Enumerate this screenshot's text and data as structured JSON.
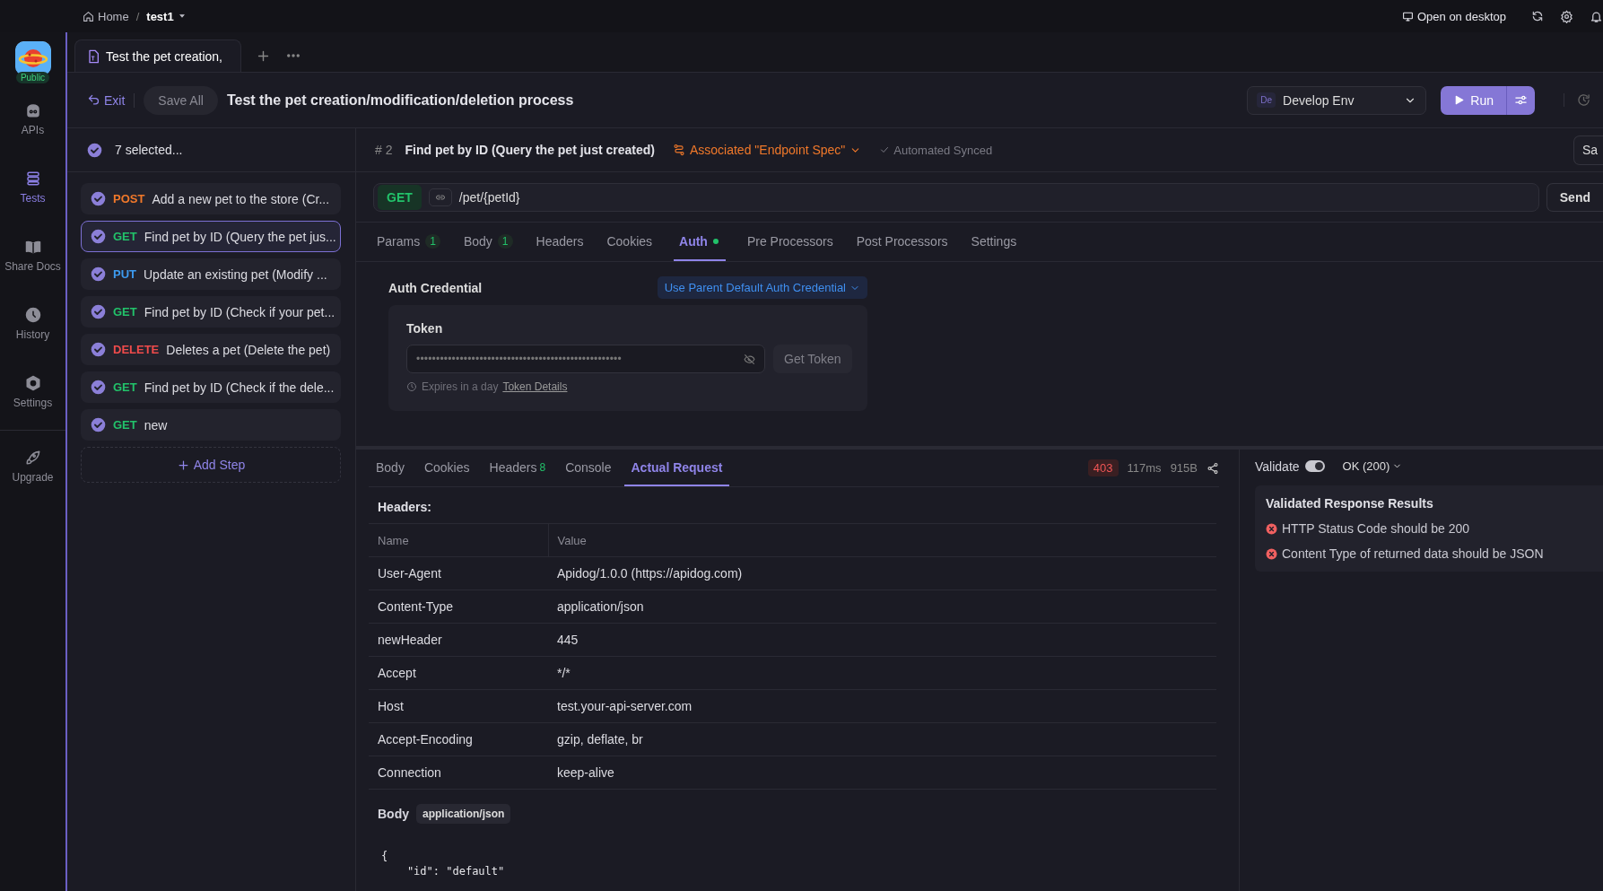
{
  "top_bar": {
    "breadcrumb": [
      {
        "label": "Home",
        "kind": "home"
      },
      {
        "label": "test1",
        "kind": "project"
      }
    ],
    "separator": "/",
    "open_desktop": "Open on desktop"
  },
  "nav": {
    "badge": "Public",
    "items": [
      {
        "label": "APIs",
        "kind": "apis",
        "selected": false
      },
      {
        "label": "Tests",
        "kind": "tests",
        "selected": true
      },
      {
        "label": "Share Docs",
        "kind": "docs",
        "selected": false
      },
      {
        "label": "History",
        "kind": "history",
        "selected": false
      },
      {
        "label": "Settings",
        "kind": "settings",
        "selected": false
      }
    ],
    "upgrade": "Upgrade"
  },
  "tabs": [
    {
      "label": "Test the pet creation,",
      "selected": true
    }
  ],
  "header": {
    "exit": "Exit",
    "save_all": "Save All",
    "title": "Test the pet creation/modification/deletion process",
    "env_badge": "De",
    "env": "Develop Env",
    "run": "Run"
  },
  "steps": {
    "selected_count": "7 selected...",
    "all_checked": true,
    "items": [
      {
        "method": "POST",
        "color": "#f0782a",
        "name": "Add a new pet to the store (Cr...",
        "checked": true,
        "selected": false
      },
      {
        "method": "GET",
        "color": "#22c26a",
        "name": "Find pet by ID (Query the pet jus...",
        "checked": true,
        "selected": true
      },
      {
        "method": "PUT",
        "color": "#3d9bf0",
        "name": "Update an existing pet (Modify ...",
        "checked": true,
        "selected": false
      },
      {
        "method": "GET",
        "color": "#22c26a",
        "name": "Find pet by ID (Check if your pet...",
        "checked": true,
        "selected": false
      },
      {
        "method": "DELETE",
        "color": "#ef4b4b",
        "name": "Deletes a pet (Delete the pet)",
        "checked": true,
        "selected": false
      },
      {
        "method": "GET",
        "color": "#22c26a",
        "name": "Find pet by ID (Check if the dele...",
        "checked": true,
        "selected": false
      },
      {
        "method": "GET",
        "color": "#22c26a",
        "name": "new",
        "checked": true,
        "selected": false
      }
    ],
    "add_step": "Add Step"
  },
  "step": {
    "number": "# 2",
    "title": "Find pet by ID (Query the pet just created)",
    "association": "Associated \"Endpoint Spec\"",
    "sync": "Automated Synced",
    "save": "Sa"
  },
  "request": {
    "method": "GET",
    "url": "/pet/{petId}",
    "send": "Send"
  },
  "request_tabs": [
    {
      "label": "Params",
      "count": "1",
      "selected": false,
      "indicator": false
    },
    {
      "label": "Body",
      "count": "1",
      "selected": false,
      "indicator": false
    },
    {
      "label": "Headers",
      "selected": false,
      "indicator": false
    },
    {
      "label": "Cookies",
      "selected": false,
      "indicator": false
    },
    {
      "label": "Auth",
      "selected": true,
      "indicator": true
    },
    {
      "label": "Pre Processors",
      "selected": false,
      "indicator": false
    },
    {
      "label": "Post Processors",
      "selected": false,
      "indicator": false
    },
    {
      "label": "Settings",
      "selected": false,
      "indicator": false
    }
  ],
  "auth": {
    "label": "Auth Credential",
    "mode": "Use Parent Default Auth Credential",
    "token_label": "Token",
    "token_value": "••••••••••••••••••••••••••••••••••••••••••••••••••••",
    "get_token": "Get Token",
    "expires": "Expires in a day",
    "details": "Token Details"
  },
  "response": {
    "tabs": [
      {
        "label": "Body",
        "selected": false
      },
      {
        "label": "Cookies",
        "selected": false
      },
      {
        "label": "Headers",
        "count": "8",
        "selected": false
      },
      {
        "label": "Console",
        "selected": false
      },
      {
        "label": "Actual Request",
        "selected": true
      }
    ],
    "status": "403",
    "time": "117ms",
    "size": "915B"
  },
  "actual_request": {
    "headers_title": "Headers:",
    "columns": [
      "Name",
      "Value"
    ],
    "rows": [
      [
        "User-Agent",
        "Apidog/1.0.0 (https://apidog.com)"
      ],
      [
        "Content-Type",
        "application/json"
      ],
      [
        "newHeader",
        "445"
      ],
      [
        "Accept",
        "*/*"
      ],
      [
        "Host",
        "test.your-api-server.com"
      ],
      [
        "Accept-Encoding",
        "gzip, deflate, br"
      ],
      [
        "Connection",
        "keep-alive"
      ]
    ],
    "body_label": "Body",
    "body_type": "application/json",
    "code": [
      "{",
      "    \"id\": \"default\""
    ]
  },
  "validation": {
    "label": "Validate",
    "on": true,
    "response": "OK (200)",
    "title": "Validated Response Results",
    "results": [
      {
        "text": "HTTP Status Code should be 200",
        "passed": false
      },
      {
        "text": "Content Type of returned data should be JSON",
        "passed": false
      }
    ]
  }
}
